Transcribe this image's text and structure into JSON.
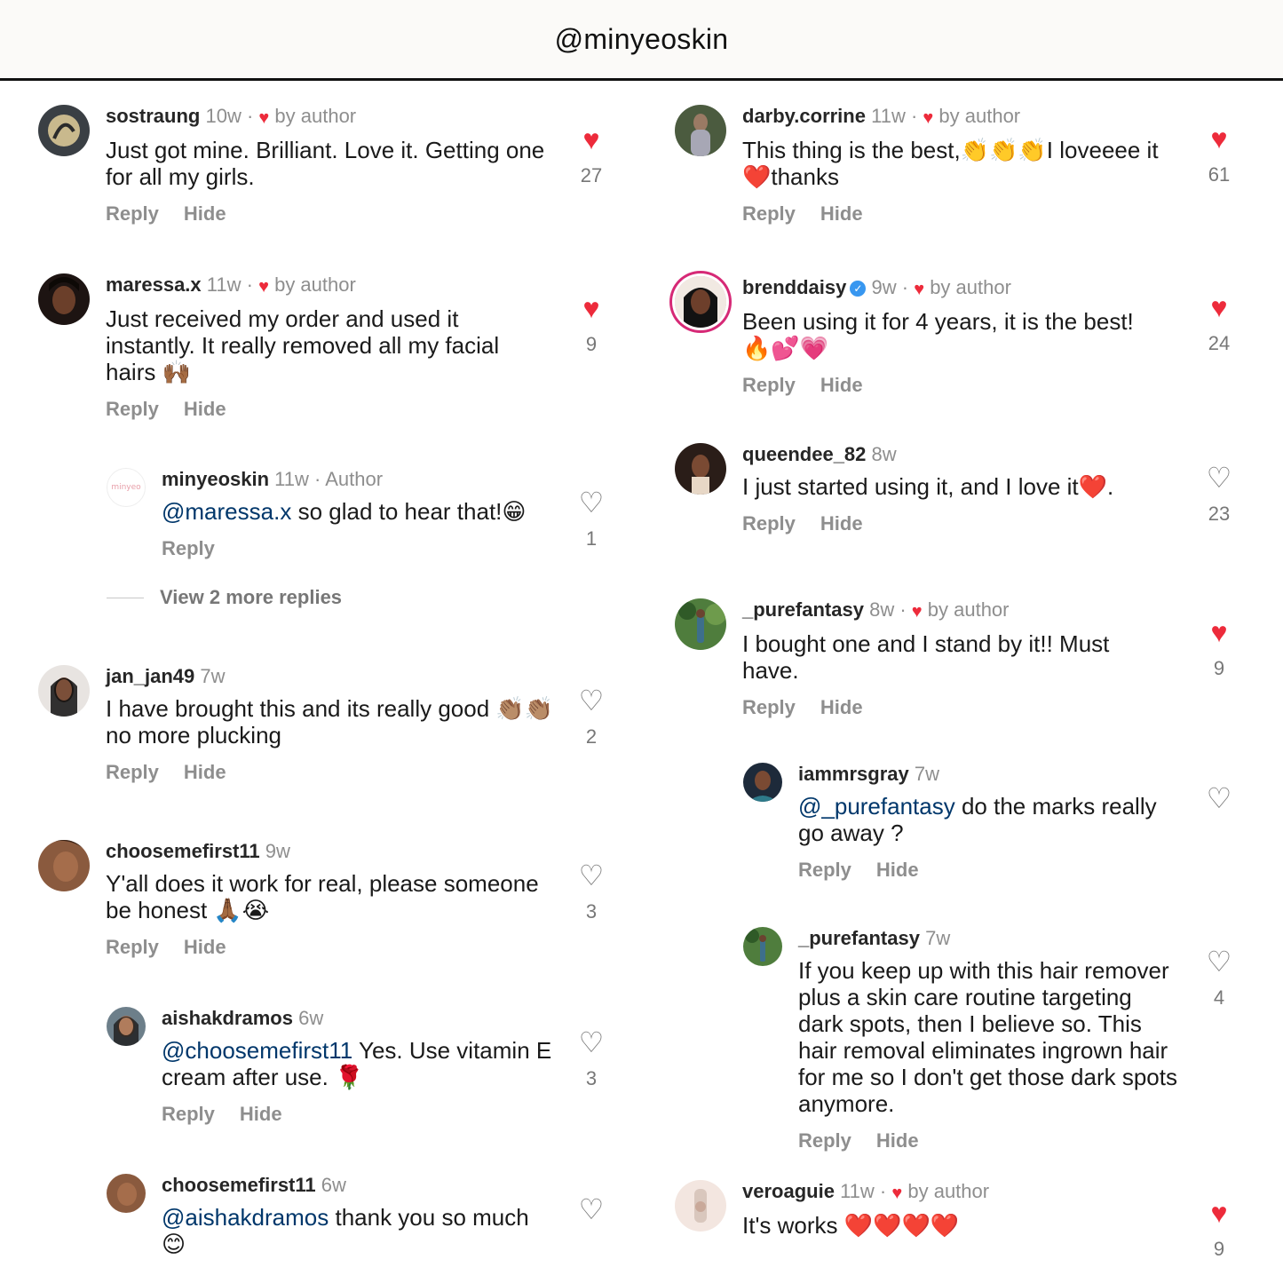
{
  "header": {
    "title": "@minyeoskin"
  },
  "labels": {
    "reply": "Reply",
    "hide": "Hide"
  },
  "view_more": "View 2 more replies",
  "colors": {
    "like_red": "#ed2b3b",
    "mention": "#00376b",
    "muted": "#8e8e8e",
    "verified": "#3897f0"
  },
  "left": [
    {
      "user": "sostraung",
      "time": "10w",
      "liked_by_author": true,
      "suffix": "by author",
      "text": "Just got mine. Brilliant. Love it. Getting one for all my girls.",
      "likes": "27",
      "liked": true
    },
    {
      "user": "maressa.x",
      "time": "11w",
      "liked_by_author": true,
      "suffix": "by author",
      "text": "Just received my order and used it instantly. It really removed all my facial hairs 🙌🏾",
      "likes": "9",
      "liked": true
    },
    {
      "user": "minyeoskin",
      "time": "11w",
      "suffix": "Author",
      "mention": "@maressa.x",
      "text": "so glad to hear that!😁",
      "likes": "1",
      "liked": false,
      "avatar_text": "minyeo"
    },
    {
      "user": "jan_jan49",
      "time": "7w",
      "text": "I have brought this and its really good 👏🏽👏🏽 no more plucking",
      "likes": "2",
      "liked": false
    },
    {
      "user": "choosemefirst11",
      "time": "9w",
      "text": "Y'all does it work for real, please someone be honest 🙏🏾😭",
      "likes": "3",
      "liked": false
    },
    {
      "user": "aishakdramos",
      "time": "6w",
      "mention": "@choosemefirst11",
      "text": " Yes. Use vitamin E cream after use. 🌹",
      "likes": "3",
      "liked": false
    },
    {
      "user": "choosemefirst11",
      "time": "6w",
      "mention": "@aishakdramos",
      "text": "thank you so much 😊",
      "liked": false
    }
  ],
  "right": [
    {
      "user": "darby.corrine",
      "time": "11w",
      "liked_by_author": true,
      "suffix": "by author",
      "text": "This thing is the best,👏👏👏I loveeee it❤️thanks",
      "likes": "61",
      "liked": true
    },
    {
      "user": "brenddaisy",
      "time": "9w",
      "verified": true,
      "liked_by_author": true,
      "suffix": "by author",
      "text": "Been using it for 4 years, it is the best! 🔥💕💗",
      "likes": "24",
      "liked": true
    },
    {
      "user": "queendee_82",
      "time": "8w",
      "text": "I just started using it, and I love it❤️.",
      "likes": "23",
      "liked": false
    },
    {
      "user": "_purefantasy",
      "time": "8w",
      "liked_by_author": true,
      "suffix": "by author",
      "text": "I bought one and I stand by it!! Must have.",
      "likes": "9",
      "liked": true
    },
    {
      "user": "iammrsgray",
      "time": "7w",
      "mention": "@_purefantasy",
      "text": "do the marks really go away ?",
      "liked": false
    },
    {
      "user": "_purefantasy",
      "time": "7w",
      "text": "If you keep up with this hair remover plus a skin care routine targeting dark spots, then I believe so. This hair removal eliminates ingrown hair for me so I don't get those dark spots anymore.",
      "likes": "4",
      "liked": false
    },
    {
      "user": "veroaguie",
      "time": "11w",
      "liked_by_author": true,
      "suffix": "by author",
      "text": "It's works ❤️❤️❤️❤️",
      "likes": "9",
      "liked": true
    }
  ]
}
